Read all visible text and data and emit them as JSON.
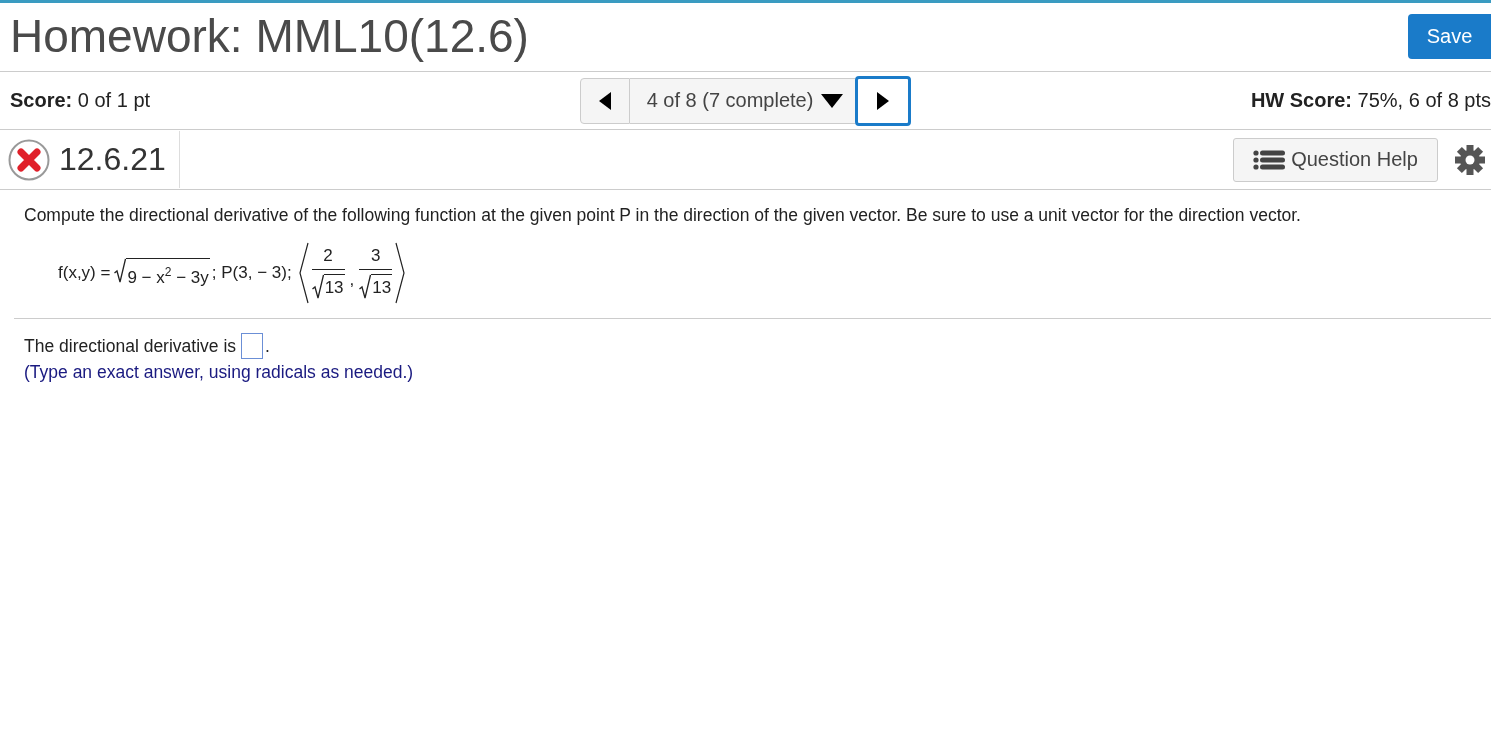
{
  "header": {
    "title": "Homework: MML10(12.6)",
    "save_button": "Save"
  },
  "score_bar": {
    "score_label": "Score:",
    "score_value": "0 of 1 pt",
    "question_selector": "4 of 8 (7 complete)",
    "next_focused": true,
    "hw_score_label": "HW Score:",
    "hw_score_value": "75%, 6 of 8 pts"
  },
  "question": {
    "correct": false,
    "number": "12.6.21",
    "help_button": "Question Help"
  },
  "prompt": "Compute the directional derivative of the following function at the given point P in the direction of the given vector. Be sure to use a unit vector for the direction vector.",
  "formula": {
    "function": "f(x,y) =",
    "radicand": "9 − x$^{2}$ − 3y",
    "point": "; P(3, − 3);",
    "separator": ",",
    "vector": [
      {
        "numerator": "2",
        "denominator": "13"
      },
      {
        "numerator": "3",
        "denominator": "13"
      }
    ]
  },
  "answer": {
    "before": "The directional derivative is",
    "after": ".",
    "hint": "(Type an exact answer, using radicals as needed.)"
  }
}
